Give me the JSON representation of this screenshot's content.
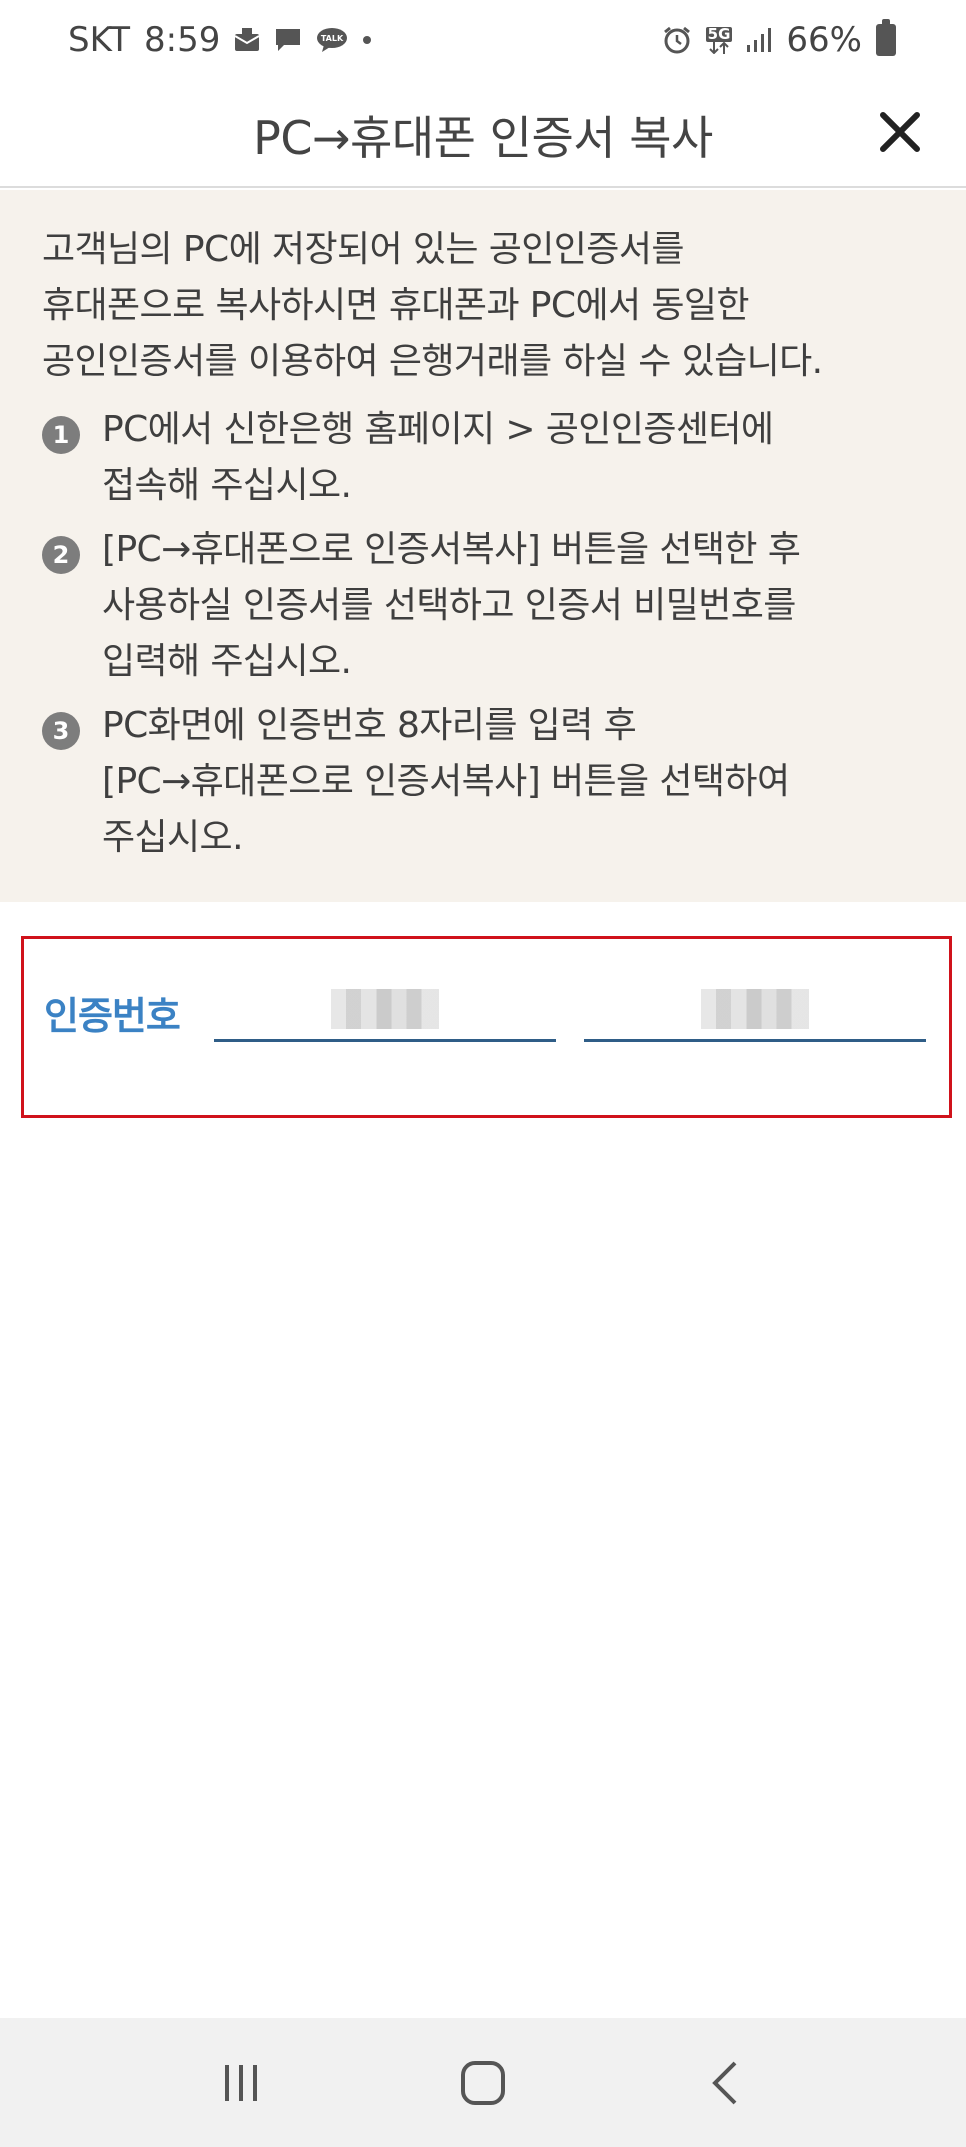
{
  "status_bar": {
    "carrier": "SKT",
    "time": "8:59",
    "network": "5G",
    "battery": "66%"
  },
  "header": {
    "title": "PC→휴대폰 인증서 복사"
  },
  "info": {
    "intro_lines": [
      "고객님의 PC에 저장되어 있는 공인인증서를",
      "휴대폰으로 복사하시면 휴대폰과 PC에서 동일한",
      "공인인증서를 이용하여 은행거래를 하실 수 있습니다."
    ],
    "steps": [
      {
        "num": "1",
        "lines": [
          "PC에서 신한은행 홈페이지 > 공인인증센터에",
          "접속해 주십시오."
        ]
      },
      {
        "num": "2",
        "lines": [
          "[PC→휴대폰으로 인증서복사] 버튼을 선택한 후",
          "사용하실 인증서를 선택하고 인증서 비밀번호를",
          "입력해 주십시오."
        ]
      },
      {
        "num": "3",
        "lines": [
          "PC화면에 인증번호 8자리를 입력 후",
          "[PC→휴대폰으로 인증서복사] 버튼을 선택하여",
          "주십시오."
        ]
      }
    ]
  },
  "verification": {
    "label": "인증번호"
  },
  "colors": {
    "info_bg": "#f6f2ec",
    "highlight_border": "#d0121b",
    "label_blue": "#3b82c4",
    "field_underline": "#2f5d87"
  }
}
